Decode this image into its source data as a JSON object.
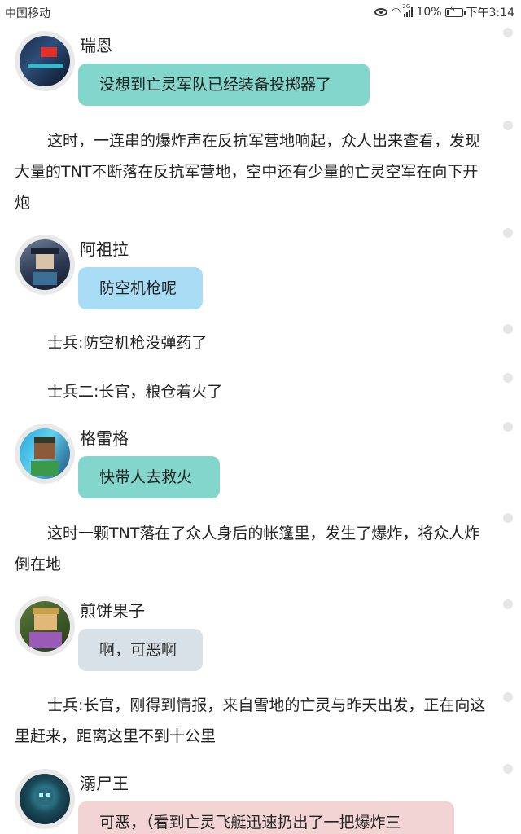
{
  "status_bar": {
    "carrier": "中国移动",
    "network": "2G",
    "battery": "10%",
    "battery_level": 0.1,
    "time": "下午3:14"
  },
  "messages": [
    {
      "speaker": "瑞恩",
      "text": "没想到亡灵军队已经装备投掷器了"
    },
    {
      "speaker": "阿祖拉",
      "text": "防空机枪呢"
    },
    {
      "speaker": "格雷格",
      "text": "快带人去救火"
    },
    {
      "speaker": "煎饼果子",
      "text": "啊，可恶啊"
    },
    {
      "speaker": "溺尸王",
      "text": "可恶，（看到亡灵飞艇迅速扔出了一把爆炸三"
    }
  ],
  "narration": [
    "这时，一连串的爆炸声在反抗军营地响起，众人出来查看，发现大量的TNT不断落在反抗军营地，空中还有少量的亡灵空军在向下开炮",
    "士兵:防空机枪没弹药了",
    "士兵二:长官，粮仓着火了",
    "这时一颗TNT落在了众人身后的帐篷里，发生了爆炸，将众人炸倒在地",
    "士兵:长官，刚得到情报，来自雪地的亡灵与昨天出发，正在向这里赶来，距离这里不到十公里"
  ],
  "colors": {
    "bubble_green": "#82d6cc",
    "bubble_blue": "#a8ddf5",
    "bubble_grey": "#d9e1e8",
    "bubble_pink": "#f2d4d4"
  }
}
